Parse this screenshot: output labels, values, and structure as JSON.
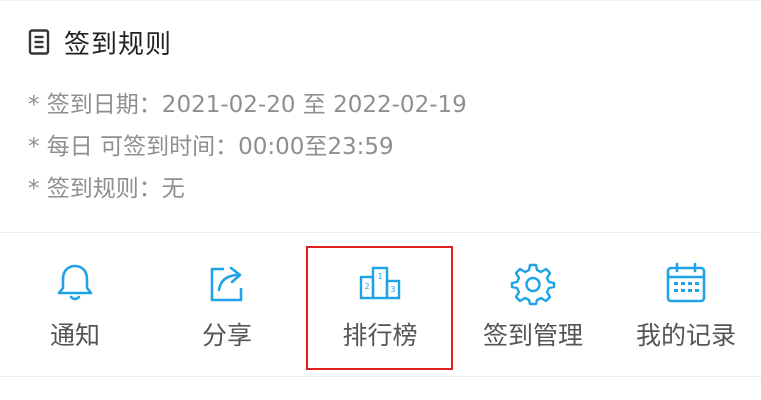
{
  "rules": {
    "title": "签到规则",
    "items": [
      "* 签到日期：2021-02-20 至 2022-02-19",
      "* 每日 可签到时间：00:00至23:59",
      "* 签到规则：无"
    ]
  },
  "actions": [
    {
      "label": "通知",
      "icon": "bell-icon"
    },
    {
      "label": "分享",
      "icon": "share-icon"
    },
    {
      "label": "排行榜",
      "icon": "podium-icon",
      "highlighted": true
    },
    {
      "label": "签到管理",
      "icon": "gear-icon"
    },
    {
      "label": "我的记录",
      "icon": "calendar-icon"
    }
  ],
  "colors": {
    "icon_blue": "#1fa2e8",
    "highlight_red": "#e02020",
    "title_text": "#222222",
    "rule_text": "#8f8f8f",
    "label_text": "#555555"
  }
}
